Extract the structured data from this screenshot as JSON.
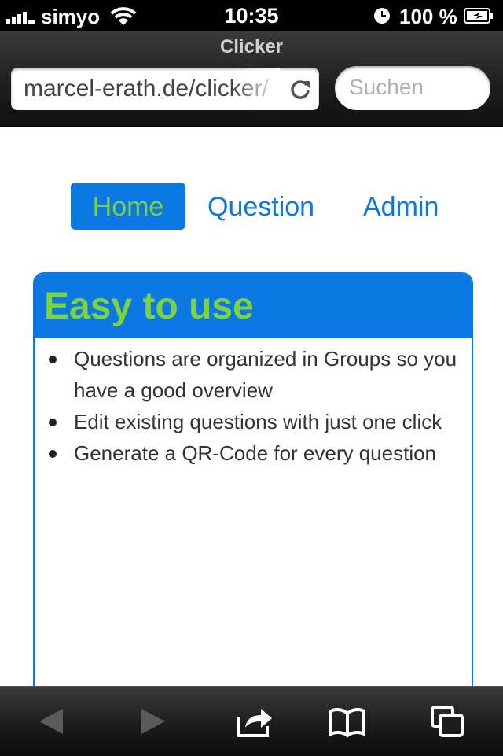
{
  "status": {
    "carrier": "simyo",
    "time": "10:35",
    "battery": "100 %"
  },
  "browser": {
    "page_title": "Clicker",
    "url": "marcel-erath.de/clicker/",
    "search_placeholder": "Suchen"
  },
  "nav": {
    "home": "Home",
    "question": "Question",
    "admin": "Admin",
    "active": "Home"
  },
  "card": {
    "title": "Easy to use",
    "items": [
      "Questions are organized in Groups so you have a good overview",
      "Edit existing questions with just one click",
      "Generate a QR-Code for every question"
    ]
  },
  "toolbar": {
    "icons": [
      "back-icon",
      "forward-icon",
      "share-icon",
      "bookmarks-icon",
      "tabs-icon"
    ]
  },
  "colors": {
    "accent_blue": "#0b78e3",
    "accent_green": "#7ed23c"
  }
}
